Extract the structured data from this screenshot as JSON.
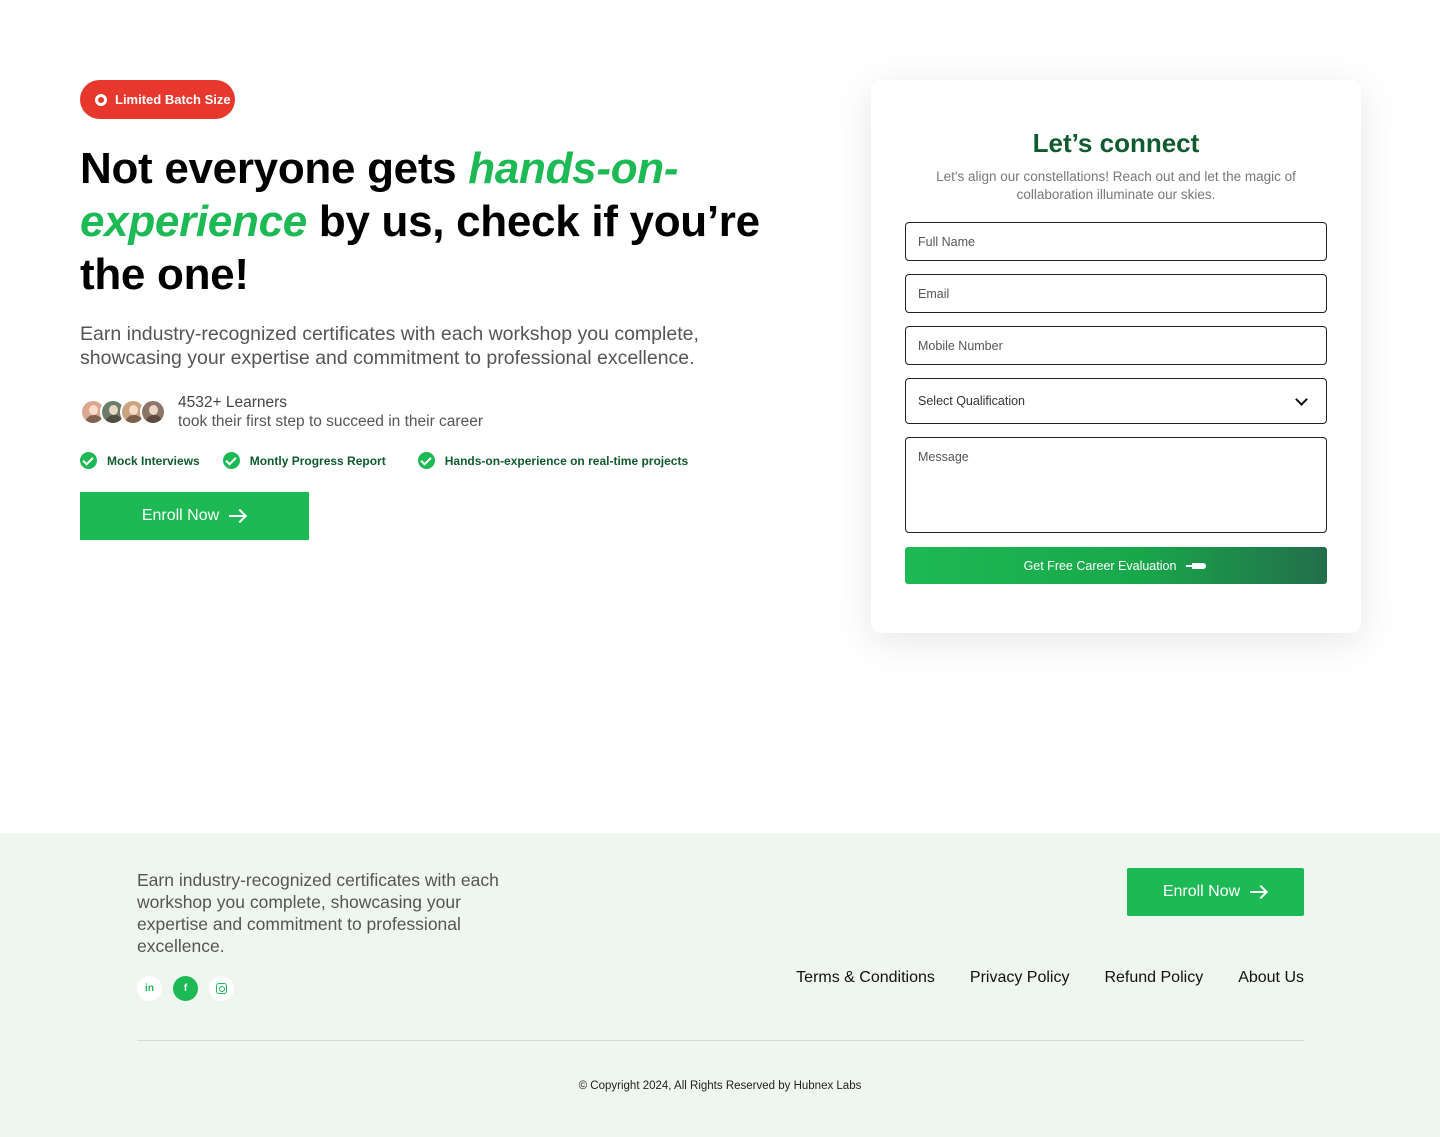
{
  "hero": {
    "badge": "Limited Batch Size",
    "headline_part1": "Not everyone gets ",
    "headline_accent": "hands-on-experience",
    "headline_part2": " by us, check if you’re the one!",
    "lead": "Earn industry-recognized certificates with each workshop you complete, showcasing your expertise and commitment to professional excellence.",
    "learners_count": "4532+ Learners",
    "learners_sub": "took their first step to succeed in their career",
    "avatar_colors": [
      "#d9a68f",
      "#6b7d6a",
      "#c9a27e",
      "#8a7566"
    ],
    "features": [
      "Mock Interviews",
      "Montly Progress Report",
      "Hands-on-experience on real-time projects"
    ],
    "enroll_label": "Enroll Now"
  },
  "form": {
    "title": "Let’s connect",
    "subtitle": "Let's align our constellations! Reach out and let the magic of collaboration illuminate our skies.",
    "full_name_placeholder": "Full Name",
    "email_placeholder": "Email",
    "mobile_placeholder": "Mobile Number",
    "qualification_selected": "Select Qualification",
    "message_placeholder": "Message",
    "submit_label": "Get Free Career Evaluation"
  },
  "footer": {
    "text": "Earn industry-recognized certificates with each workshop you complete, showcasing your expertise and commitment to professional excellence.",
    "enroll_label": "Enroll Now",
    "social_linkedin": "in",
    "social_facebook": "f",
    "links": [
      "Terms & Conditions",
      "Privacy Policy",
      "Refund Policy",
      "About Us"
    ],
    "copyright": "© Copyright 2024, All Rights Reserved by Hubnex Labs"
  },
  "colors": {
    "brand_green": "#1db954",
    "dark_green": "#0f5a2f",
    "badge_red": "#e8372d",
    "footer_bg": "#eff6ef"
  },
  "icons": [
    "badge-dot-icon",
    "check-icon",
    "arrow-right-icon",
    "chevron-down-icon",
    "rocket-icon",
    "linkedin-icon",
    "facebook-icon",
    "instagram-icon"
  ]
}
